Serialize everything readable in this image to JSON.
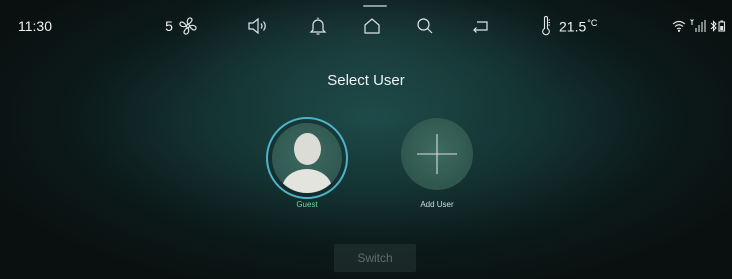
{
  "status_bar": {
    "time": "11:30",
    "fan_speed": "5",
    "temperature": "21.5",
    "temperature_unit": "°C",
    "icons": [
      "fan-icon",
      "volume-icon",
      "bell-icon",
      "home-icon",
      "search-icon",
      "back-icon",
      "thermometer-icon",
      "wifi-icon",
      "signal-icon",
      "bluetooth-battery-icon"
    ]
  },
  "main": {
    "title": "Select User",
    "users": [
      {
        "label": "Guest",
        "icon": "user-avatar-icon",
        "selected": true
      }
    ],
    "add_user_label": "Add User",
    "switch_label": "Switch"
  },
  "colors": {
    "selected_ring": "#4fb2c8",
    "selected_label": "#6ed39a",
    "background": "#143433"
  }
}
